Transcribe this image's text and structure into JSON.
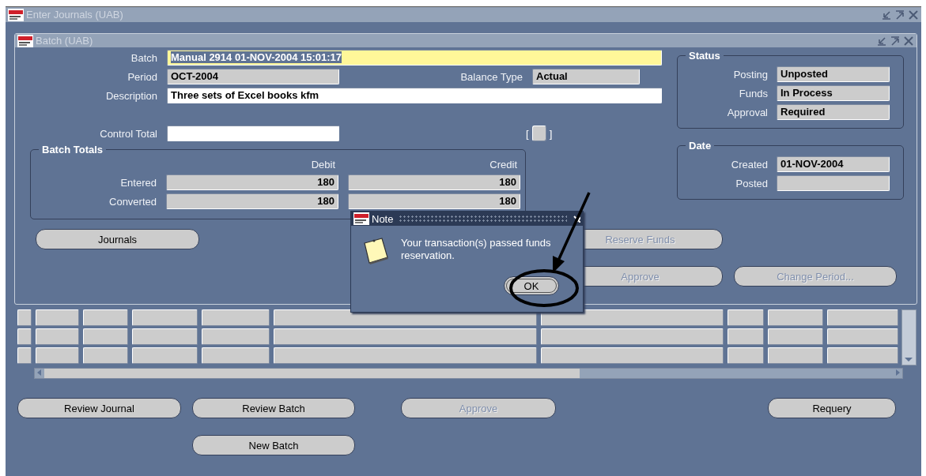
{
  "outer_window": {
    "title": "Enter Journals (UAB)"
  },
  "batch_window": {
    "title": "Batch (UAB)",
    "batch": {
      "label": "Batch",
      "value": "Manual 2914 01-NOV-2004 15:01:17",
      "focused": true
    },
    "period": {
      "label": "Period",
      "value": "OCT-2004"
    },
    "balance_type": {
      "label": "Balance Type",
      "value": "Actual"
    },
    "description": {
      "label": "Description",
      "value": "Three sets of Excel books kfm"
    },
    "control_total": {
      "label": "Control Total"
    },
    "checkbox": {
      "open": "[",
      "close": "]",
      "checked": false
    },
    "batch_totals": {
      "title": "Batch Totals",
      "columns": [
        "Debit",
        "Credit"
      ],
      "rows": [
        {
          "label": "Entered",
          "debit": "180",
          "credit": "180"
        },
        {
          "label": "Converted",
          "debit": "180",
          "credit": "180"
        }
      ]
    },
    "status": {
      "title": "Status",
      "fields": [
        {
          "label": "Posting",
          "value": "Unposted"
        },
        {
          "label": "Funds",
          "value": "In Process"
        },
        {
          "label": "Approval",
          "value": "Required"
        }
      ]
    },
    "date": {
      "title": "Date",
      "fields": [
        {
          "label": "Created",
          "value": "01-NOV-2004"
        },
        {
          "label": "Posted"
        }
      ]
    },
    "buttons": [
      {
        "label": "Journals",
        "disabled": false
      },
      {
        "label": "Reserve Funds",
        "disabled": true
      },
      {
        "label": "Approve",
        "disabled": true
      },
      {
        "label": "Change Period...",
        "disabled": true
      }
    ]
  },
  "bottom_buttons": [
    {
      "label": "Review Journal",
      "disabled": false
    },
    {
      "label": "Review Batch",
      "disabled": false
    },
    {
      "label": "Approve",
      "disabled": true
    },
    {
      "label": "Requery",
      "disabled": false
    },
    {
      "label": "New Batch",
      "disabled": false
    }
  ],
  "note_dialog": {
    "title": "Note",
    "message": "Your transaction(s) passed funds reservation.",
    "ok": "OK"
  }
}
